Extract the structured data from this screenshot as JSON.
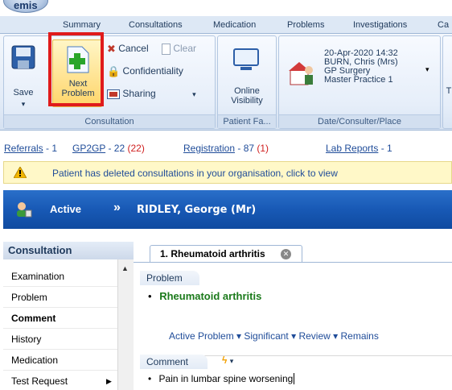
{
  "app": {
    "orb_label": "emis"
  },
  "ribbon_tabs": [
    "Summary",
    "Consultations",
    "Medication",
    "Problems",
    "Investigations",
    "Ca"
  ],
  "ribbon": {
    "save_label": "Save",
    "next_problem_label_1": "Next",
    "next_problem_label_2": "Problem",
    "cancel_label": "Cancel",
    "clear_label": "Clear",
    "confidentiality_label": "Confidentiality",
    "sharing_label": "Sharing",
    "consultation_group": "Consultation",
    "online_visibility_label_1": "Online",
    "online_visibility_label_2": "Visibility",
    "patient_fa_group": "Patient Fa...",
    "datetime": "20-Apr-2020 14:32",
    "consulter": "BURN, Chris (Mrs)",
    "consultation_type": "GP Surgery",
    "place": "Master Practice 1",
    "date_group": "Date/Consulter/Place",
    "next_group_initial": "T"
  },
  "links": {
    "referrals_label": "Referrals",
    "referrals_count": " - 1",
    "gp2gp_label": "GP2GP",
    "gp2gp_count": " - 22 ",
    "gp2gp_red": "(22)",
    "registration_label": "Registration",
    "registration_count": " - 87 ",
    "registration_red": "(1)",
    "lab_label": "Lab Reports",
    "lab_count": " - 1"
  },
  "warning": {
    "text": "Patient has deleted consultations in your organisation, click to view"
  },
  "patient": {
    "status": "Active",
    "chevron": "»",
    "name": "RIDLEY, George (Mr)"
  },
  "leftnav": {
    "header": "Consultation",
    "items": [
      "Examination",
      "Problem",
      "Comment",
      "History",
      "Medication",
      "Test Request"
    ]
  },
  "document": {
    "tab_title": "1. Rheumatoid arthritis",
    "problem_header": "Problem",
    "problem_name": "Rheumatoid arthritis",
    "actions": "Active Problem ▾  Significant ▾  Review ▾  Remains",
    "comment_header": "Comment",
    "comment_text": "Pain in lumbar spine worsening"
  },
  "colors": {
    "highlight": "#e01b1b",
    "patient_bar": "#1859b5",
    "problem_green": "#1b7a1b"
  }
}
